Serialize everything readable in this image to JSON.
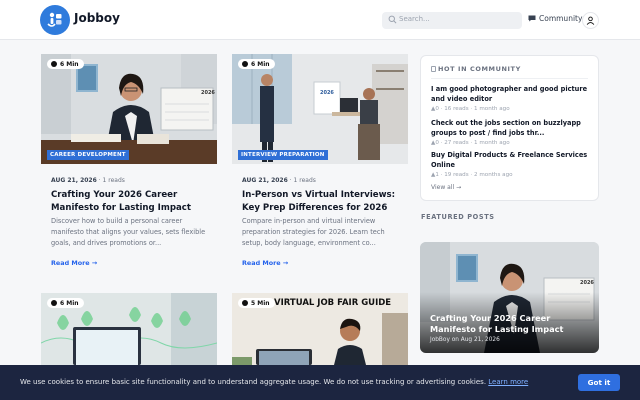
{
  "header": {
    "brand": "Jobboy",
    "search_placeholder": "Search...",
    "community_label": "Community"
  },
  "articles": [
    {
      "read_time": "6 Min",
      "category": "CAREER DEVELOPMENT",
      "date": "AUG 21, 2026",
      "reads": "1 reads",
      "title": "Crafting Your 2026 Career Manifesto for Lasting Impact",
      "excerpt": "Discover how to build a personal career manifesto that aligns your values, sets flexible goals, and drives promotions or...",
      "read_more": "Read More →",
      "image_text": "2026"
    },
    {
      "read_time": "6 Min",
      "category": "INTERVIEW PREPARATION",
      "date": "AUG 21, 2026",
      "reads": "1 reads",
      "title": "In-Person vs Virtual Interviews: Key Prep Differences for 2026",
      "excerpt": "Compare in-person and virtual interview preparation strategies for 2026. Learn tech setup, body language, environment co...",
      "read_more": "Read More →",
      "image_text": "2026"
    },
    {
      "read_time": "6 Min"
    },
    {
      "read_time": "5 Min",
      "image_heading": "VIRTUAL JOB FAIR GUIDE"
    }
  ],
  "hot_community": {
    "title": "HOT IN COMMUNITY",
    "items": [
      {
        "title": "I am good photographer and good picture and video editor",
        "votes": "0",
        "reads": "16 reads",
        "time": "1 month ago"
      },
      {
        "title": "Check out the jobs section on buzzlyapp groups to post / find jobs thr...",
        "votes": "0",
        "reads": "27 reads",
        "time": "1 month ago"
      },
      {
        "title": "Buy Digital Products & Freelance Services Online",
        "votes": "1",
        "reads": "19 reads",
        "time": "2 months ago"
      }
    ],
    "view_all": "View all →"
  },
  "featured": {
    "label": "FEATURED POSTS",
    "title": "Crafting Your 2026 Career Manifesto for Lasting Impact",
    "meta": "JobBoy on Aug 21, 2026",
    "image_text": "2026"
  },
  "cookie": {
    "text": "We use cookies to ensure basic site functionality and to understand aggregate usage. We do not use tracking or advertising cookies.",
    "link": "Learn more",
    "button": "Got it"
  },
  "colors": {
    "accent": "#2f6fd6",
    "link": "#2563eb",
    "cookie_bg": "#1c2540"
  }
}
